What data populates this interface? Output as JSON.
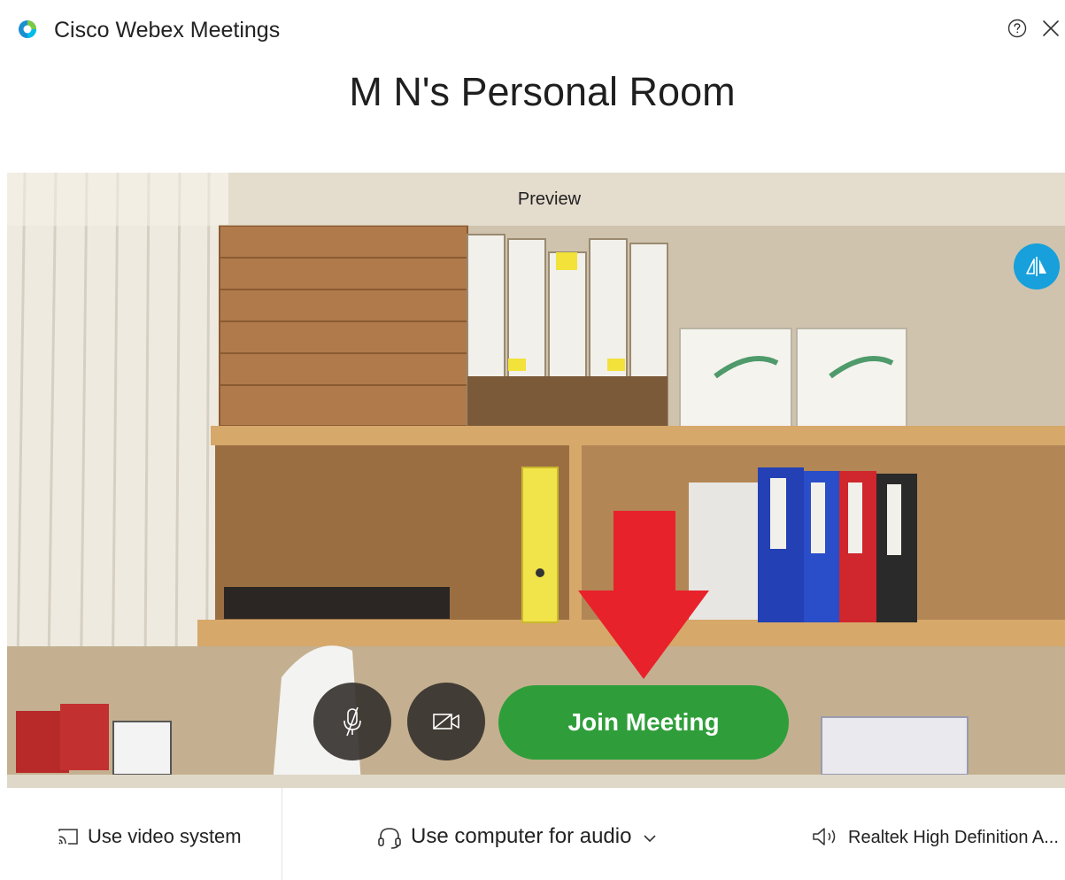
{
  "window": {
    "app_title": "Cisco Webex Meetings",
    "help_icon": "help-circle-icon",
    "close_icon": "close-icon"
  },
  "room": {
    "title": "M N's Personal Room"
  },
  "preview": {
    "label": "Preview",
    "mirror_icon": "mirror-flip-icon"
  },
  "controls": {
    "mute_icon": "microphone-muted-icon",
    "video_icon": "video-camera-off-icon",
    "join_label": "Join Meeting",
    "join_color": "#2f9e3a"
  },
  "bottom": {
    "video_system_label": "Use video system",
    "audio_label": "Use computer for audio",
    "speaker_label": "Realtek High Definition A..."
  },
  "colors": {
    "accent_blue": "#17a0db",
    "arrow_red": "#e8222a"
  }
}
